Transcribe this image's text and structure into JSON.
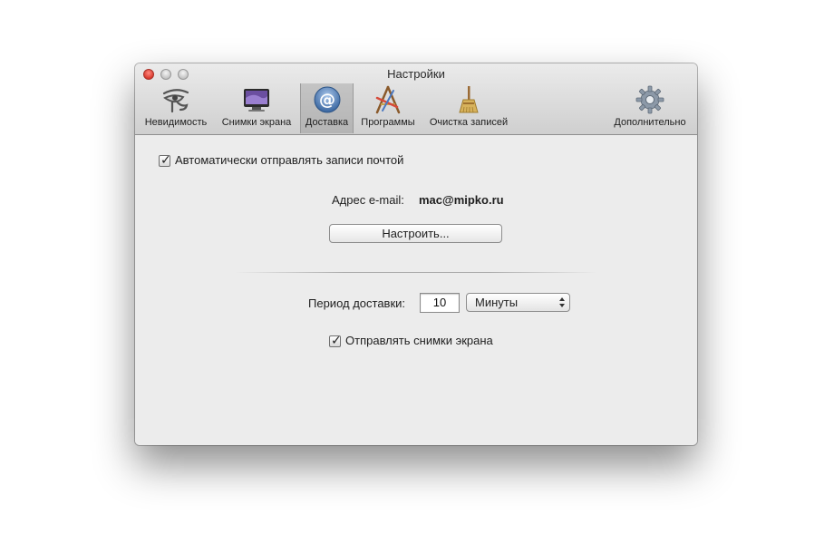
{
  "window": {
    "title": "Настройки"
  },
  "toolbar": {
    "items": [
      {
        "label": "Невидимость",
        "icon": "eye-of-horus-icon"
      },
      {
        "label": "Снимки экрана",
        "icon": "screen-monitor-icon"
      },
      {
        "label": "Доставка",
        "icon": "at-sign-icon"
      },
      {
        "label": "Программы",
        "icon": "applications-icon"
      },
      {
        "label": "Очистка записей",
        "icon": "broom-icon"
      },
      {
        "label": "Дополнительно",
        "icon": "gear-icon"
      }
    ],
    "selected": "Доставка"
  },
  "delivery": {
    "auto_send_label": "Автоматически отправлять записи почтой",
    "auto_send_checked": true,
    "email_label": "Адрес e-mail:",
    "email_value": "mac@mipko.ru",
    "configure_button": "Настроить...",
    "period_label": "Период доставки:",
    "period_value": "10",
    "period_unit": "Минуты",
    "send_screenshots_label": "Отправлять снимки экрана",
    "send_screenshots_checked": true
  },
  "colors": {
    "selected_tab": "#b8b8b8",
    "close_button": "#e0443a",
    "at_icon": "#5b86b8"
  }
}
